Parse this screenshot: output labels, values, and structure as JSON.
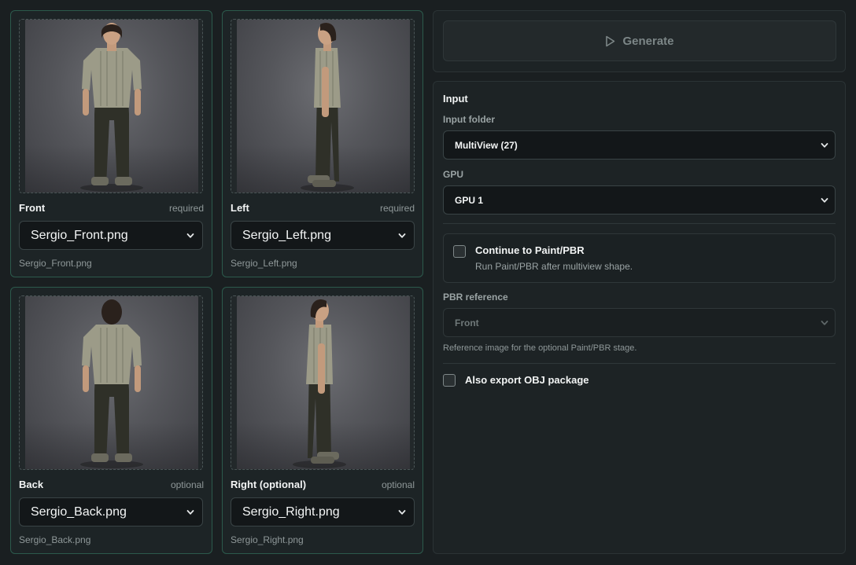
{
  "views": [
    {
      "key": "front",
      "title": "Front",
      "requirement": "required",
      "file": "Sergio_Front.png",
      "caption": "Sergio_Front.png",
      "pose": "front"
    },
    {
      "key": "left",
      "title": "Left",
      "requirement": "required",
      "file": "Sergio_Left.png",
      "caption": "Sergio_Left.png",
      "pose": "left"
    },
    {
      "key": "back",
      "title": "Back",
      "requirement": "optional",
      "file": "Sergio_Back.png",
      "caption": "Sergio_Back.png",
      "pose": "back"
    },
    {
      "key": "right",
      "title": "Right (optional)",
      "requirement": "optional",
      "file": "Sergio_Right.png",
      "caption": "Sergio_Right.png",
      "pose": "right"
    }
  ],
  "generate": {
    "label": "Generate",
    "icon": "play-icon"
  },
  "input": {
    "section_title": "Input",
    "folder_label": "Input folder",
    "folder_value": "MultiView (27)",
    "gpu_label": "GPU",
    "gpu_value": "GPU 1"
  },
  "paint": {
    "checked": false,
    "title": "Continue to Paint/PBR",
    "description": "Run Paint/PBR after multiview shape."
  },
  "pbr": {
    "label": "PBR reference",
    "value": "Front",
    "hint": "Reference image for the optional Paint/PBR stage."
  },
  "obj": {
    "checked": false,
    "label": "Also export OBJ package"
  },
  "colors": {
    "accent_border": "#2c5a4c",
    "background": "#1a1f21",
    "panel": "#1d2325"
  }
}
